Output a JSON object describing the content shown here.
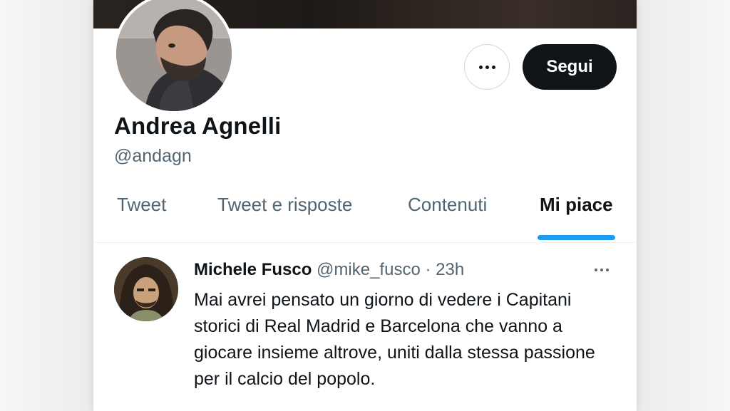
{
  "profile": {
    "name": "Andrea Agnelli",
    "handle": "@andagn",
    "follow_label": "Segui",
    "more_icon": "more-horizontal-icon"
  },
  "tabs": [
    {
      "label": "Tweet",
      "active": false
    },
    {
      "label": "Tweet e risposte",
      "active": false
    },
    {
      "label": "Contenuti",
      "active": false
    },
    {
      "label": "Mi piace",
      "active": true
    }
  ],
  "tweet": {
    "author": "Michele Fusco",
    "handle": "@mike_fusco",
    "separator": "·",
    "time": "23h",
    "text": "Mai avrei pensato un giorno di vedere i Capitani storici di Real Madrid e Barcelona che vanno a giocare insieme altrove, uniti dalla stessa passione per il calcio del popolo."
  },
  "colors": {
    "accent": "#1d9bf0",
    "text_primary": "#0f1419",
    "text_secondary": "#536471",
    "button_dark": "#0f1419"
  }
}
